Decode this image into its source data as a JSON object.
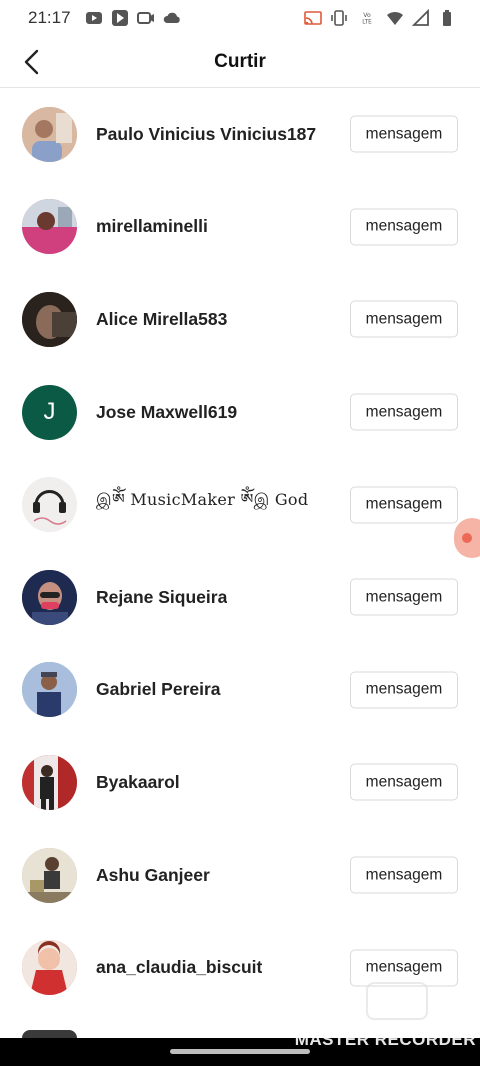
{
  "status_bar": {
    "time": "21:17",
    "left_icons": [
      "youtube-icon",
      "play-store-icon",
      "camera-icon",
      "cloud-icon"
    ],
    "right_icons": [
      "cast-icon",
      "vibrate-icon",
      "volte-icon",
      "wifi-icon",
      "signal-icon",
      "battery-icon"
    ],
    "volte_label": "Vo LTE"
  },
  "header": {
    "title": "Curtir",
    "back_icon": "back-arrow-icon"
  },
  "users": [
    {
      "name": "Paulo Vinicius Vinicius187",
      "button": "mensagem",
      "avatar_color": "#c9a38f"
    },
    {
      "name": "mirellaminelli",
      "button": "mensagem",
      "avatar_color": "#c94a8a"
    },
    {
      "name": "Alice Mirella583",
      "button": "mensagem",
      "avatar_color": "#4a3a30"
    },
    {
      "name": "Jose Maxwell619",
      "button": "mensagem",
      "avatar_color": "#0b5a45",
      "initial": "J"
    },
    {
      "name": "இༀ MusicMaker ༀஇ God",
      "button": "mensagem",
      "avatar_color": "#f1eeee"
    },
    {
      "name": "Rejane Siqueira",
      "button": "mensagem",
      "avatar_color": "#2b3a66"
    },
    {
      "name": "Gabriel Pereira",
      "button": "mensagem",
      "avatar_color": "#7f9cc8"
    },
    {
      "name": "Byakaarol",
      "button": "mensagem",
      "avatar_color": "#8a2a2a"
    },
    {
      "name": "Ashu Ganjeer",
      "button": "mensagem",
      "avatar_color": "#b7a585"
    },
    {
      "name": "ana_claudia_biscuit",
      "button": "mensagem",
      "avatar_color": "#d86a5a"
    }
  ],
  "watermark": "MASTER RECORDER",
  "colors": {
    "jose_avatar": "#0b5a45",
    "floating_bubble": "#ec6a55",
    "divider": "#e6e6e6",
    "button_border": "#d9d9d9"
  }
}
